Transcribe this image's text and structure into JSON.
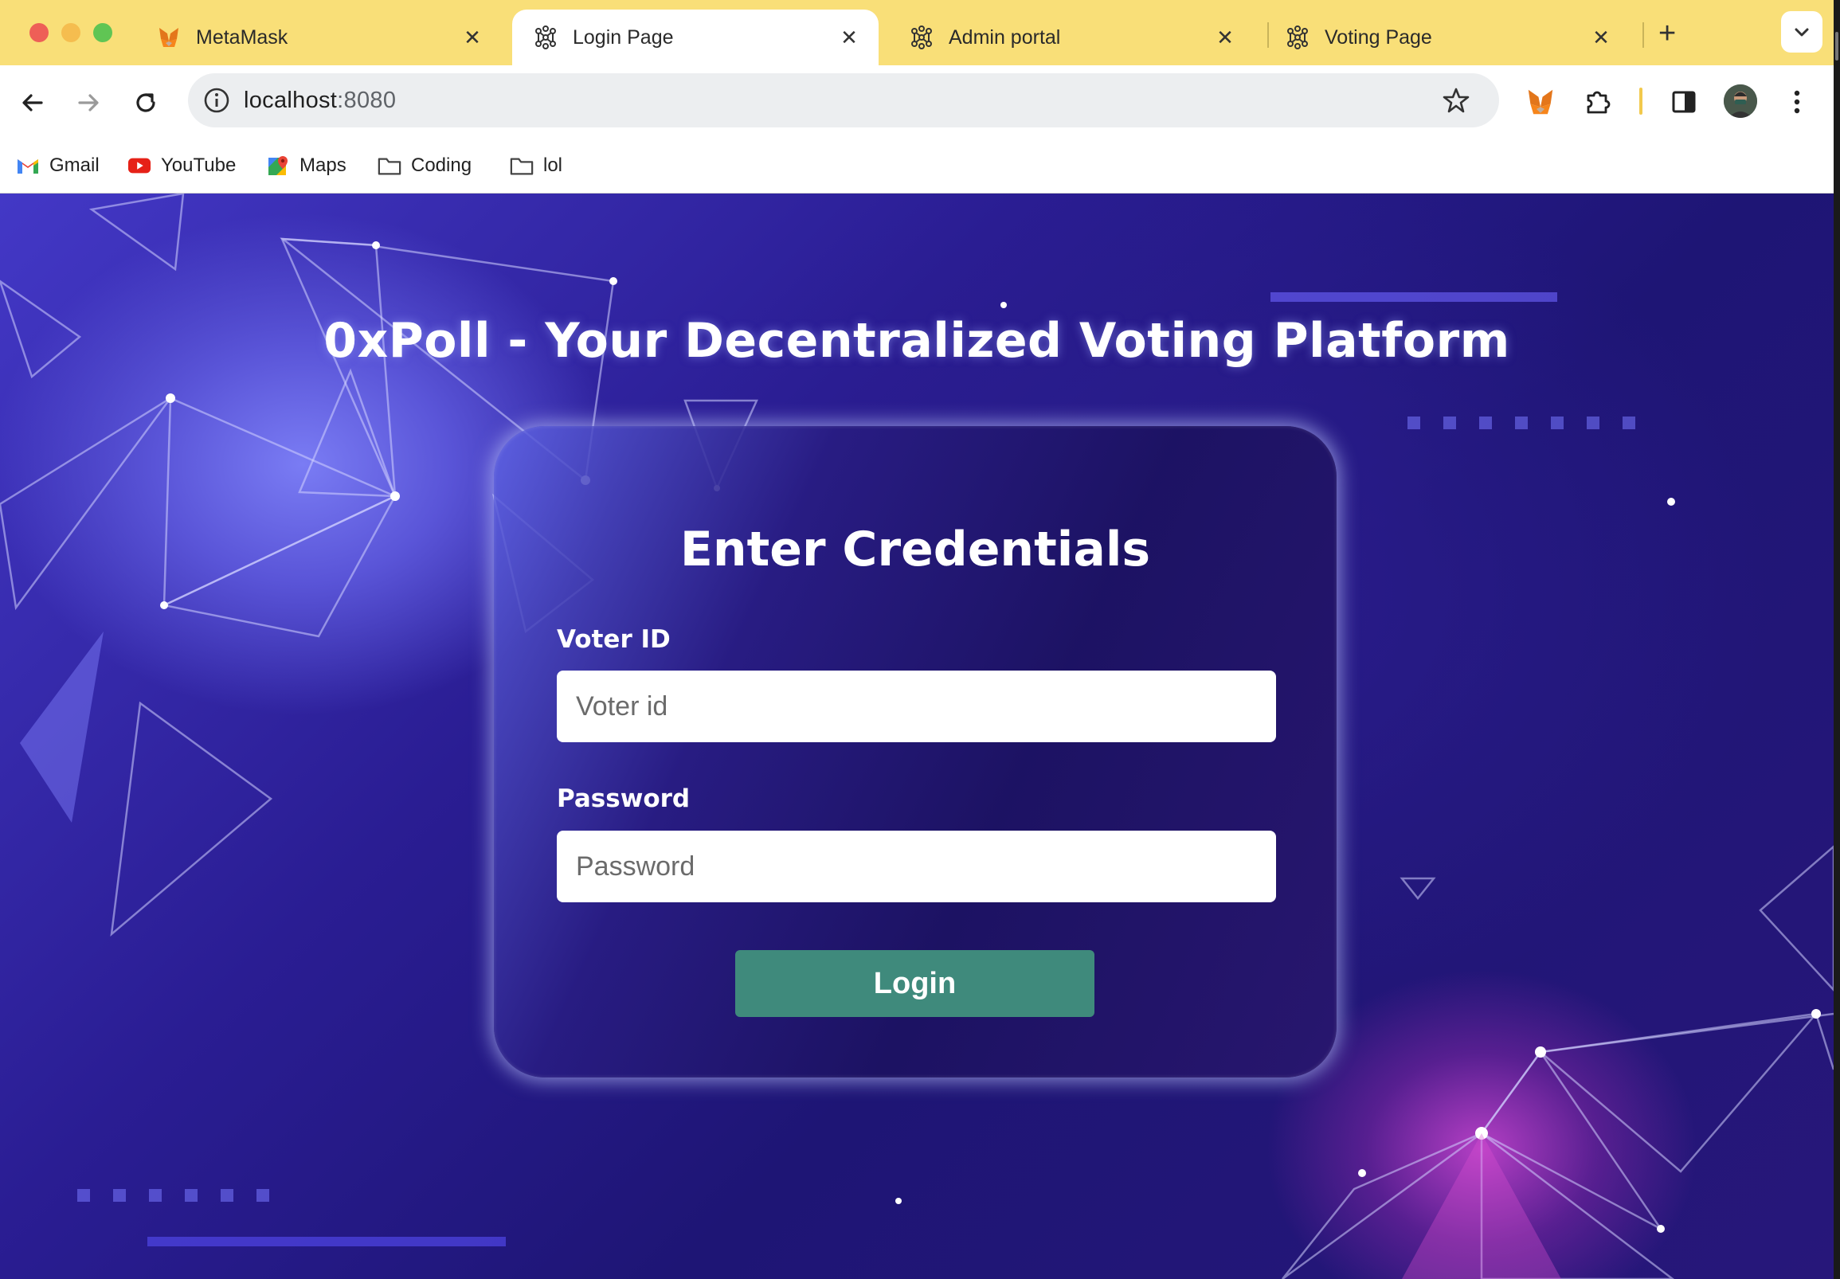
{
  "browser": {
    "tabs": [
      {
        "title": "MetaMask",
        "icon": "metamask-fox-icon",
        "active": false
      },
      {
        "title": "Login Page",
        "icon": "network-icon",
        "active": true
      },
      {
        "title": "Admin portal",
        "icon": "network-icon",
        "active": false
      },
      {
        "title": "Voting Page",
        "icon": "network-icon",
        "active": false
      }
    ],
    "address_bar": {
      "host": "localhost",
      "port": ":8080"
    },
    "bookmarks": [
      {
        "label": "Gmail",
        "icon": "gmail-icon"
      },
      {
        "label": "YouTube",
        "icon": "youtube-icon"
      },
      {
        "label": "Maps",
        "icon": "maps-icon"
      },
      {
        "label": "Coding",
        "icon": "folder-icon"
      },
      {
        "label": "lol",
        "icon": "folder-icon"
      }
    ],
    "colors": {
      "tabstrip": "#f9df78",
      "active_tab": "#ffffff"
    }
  },
  "page": {
    "headline": "0xPoll - Your Decentralized Voting Platform",
    "form": {
      "title": "Enter Credentials",
      "voter_id_label": "Voter ID",
      "voter_id_placeholder": "Voter id",
      "voter_id_value": "",
      "password_label": "Password",
      "password_placeholder": "Password",
      "password_value": "",
      "login_label": "Login"
    },
    "colors": {
      "login_button": "#3f8a7c",
      "text": "#ffffff"
    }
  }
}
